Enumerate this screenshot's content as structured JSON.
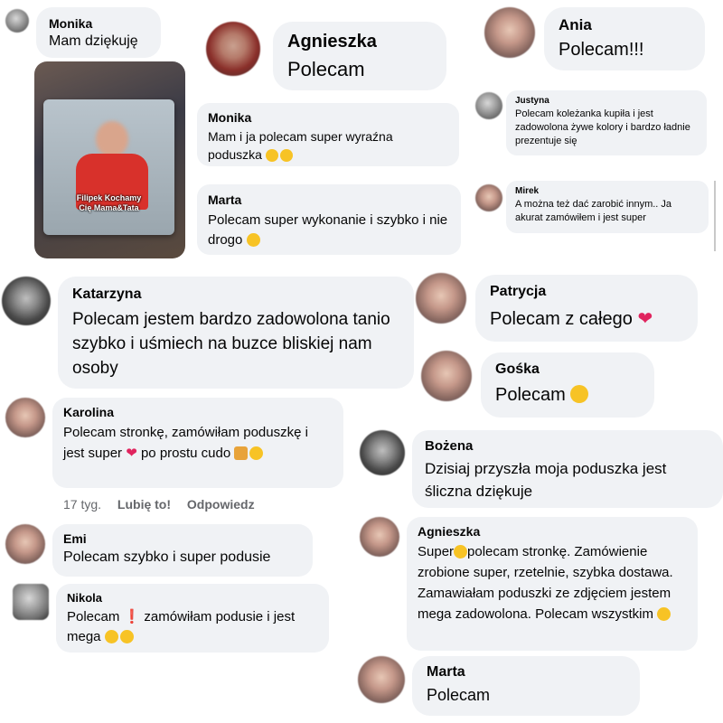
{
  "comments": {
    "monika1": {
      "name": "Monika",
      "text": "Mam dziękuję"
    },
    "agnieszka1": {
      "name": "Agnieszka",
      "text": "Polecam"
    },
    "ania": {
      "name": "Ania",
      "text": "Polecam!!!"
    },
    "monika2": {
      "name": "Monika",
      "text": "Mam i ja polecam super wyraźna poduszka"
    },
    "justyna": {
      "name": "Justyna",
      "text": "Polecam koleżanka kupiła i jest zadowolona żywe kolory i bardzo ładnie prezentuje się"
    },
    "marta1": {
      "name": "Marta",
      "text": "Polecam super wykonanie i szybko i nie drogo"
    },
    "mirek": {
      "name": "Mirek",
      "text": "A można też dać zarobić innym.. Ja akurat zamówiłem i jest super"
    },
    "katarzyna": {
      "name": "Katarzyna",
      "text": "Polecam jestem bardzo zadowolona tanio szybko i uśmiech na buzce bliskiej nam osoby"
    },
    "patrycja": {
      "name": "Patrycja",
      "text": "Polecam z całego"
    },
    "goska": {
      "name": "Gośka",
      "text": "Polecam"
    },
    "karolina": {
      "name": "Karolina",
      "text_a": "Polecam stronkę, zamówiłam poduszkę i jest super",
      "text_b": "po prostu cudo"
    },
    "bozena": {
      "name": "Bożena",
      "text": "Dzisiaj przyszła moja poduszka jest śliczna dziękuje"
    },
    "emi": {
      "name": "Emi",
      "text": "Polecam szybko i super  podusie"
    },
    "agnieszka2": {
      "name": "Agnieszka",
      "text_a": "Super",
      "text_b": "polecam stronkę. Zamówienie zrobione super, rzetelnie, szybka dostawa. Zamawiałam poduszki ze zdjęciem jestem mega zadowolona. Polecam wszystkim"
    },
    "nikola": {
      "name": "Nikola",
      "text_a": "Polecam",
      "text_b": "zamówiłam podusie i jest mega"
    },
    "marta2": {
      "name": "Marta",
      "text": "Polecam"
    }
  },
  "karolina_meta": {
    "time": "17 tyg.",
    "like": "Lubię to!",
    "reply": "Odpowiedz"
  },
  "photo": {
    "caption_line1": "Filipek Kochamy",
    "caption_line2": "Cię Mama&Tata"
  },
  "icons": {
    "smile": "grinning-face-icon",
    "heart": "red-heart-icon",
    "gift": "gift-icon",
    "heart_eyes": "heart-eyes-icon",
    "wink": "winking-face-icon",
    "hug": "smiling-hearts-icon",
    "sparkle_heart": "sparkling-heart-icon"
  },
  "colors": {
    "bubble": "#f0f2f5",
    "text": "#050505",
    "meta": "#65676b",
    "heart": "#e0245e"
  }
}
